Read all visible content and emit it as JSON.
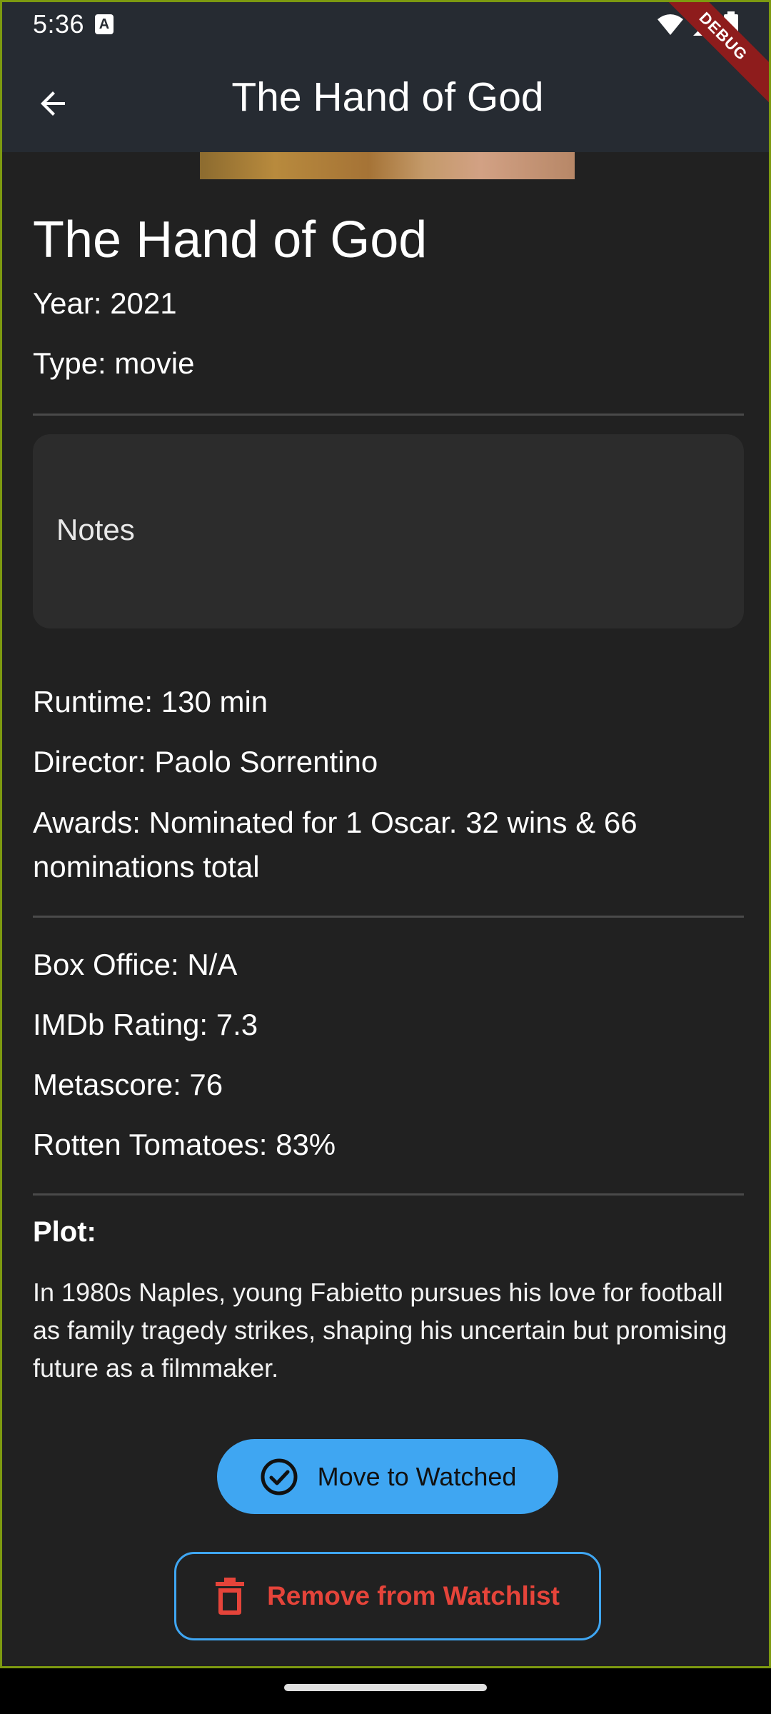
{
  "status_bar": {
    "time": "5:36",
    "notification_badge": "A"
  },
  "app_bar": {
    "title": "The Hand of God",
    "debug_label": "DEBUG"
  },
  "movie": {
    "title": "The Hand of God",
    "year": "Year: 2021",
    "type": "Type: movie",
    "notes_label": "Notes",
    "runtime": "Runtime: 130 min",
    "director": "Director: Paolo Sorrentino",
    "awards": "Awards: Nominated for 1 Oscar. 32 wins & 66 nominations total",
    "box_office": "Box Office: N/A",
    "imdb_rating": "IMDb Rating: 7.3",
    "metascore": "Metascore: 76",
    "rotten_tomatoes": "Rotten Tomatoes: 83%",
    "plot_label": "Plot:",
    "plot": "In 1980s Naples, young Fabietto pursues his love for football as family tragedy strikes, shaping his uncertain but promising future as a filmmaker."
  },
  "actions": {
    "move_to_watched": "Move to Watched",
    "remove_from_watchlist": "Remove from Watchlist"
  },
  "colors": {
    "background": "#212121",
    "app_bar": "#262b32",
    "accent_blue": "#3fa6f2",
    "danger_red": "#e5443a"
  }
}
